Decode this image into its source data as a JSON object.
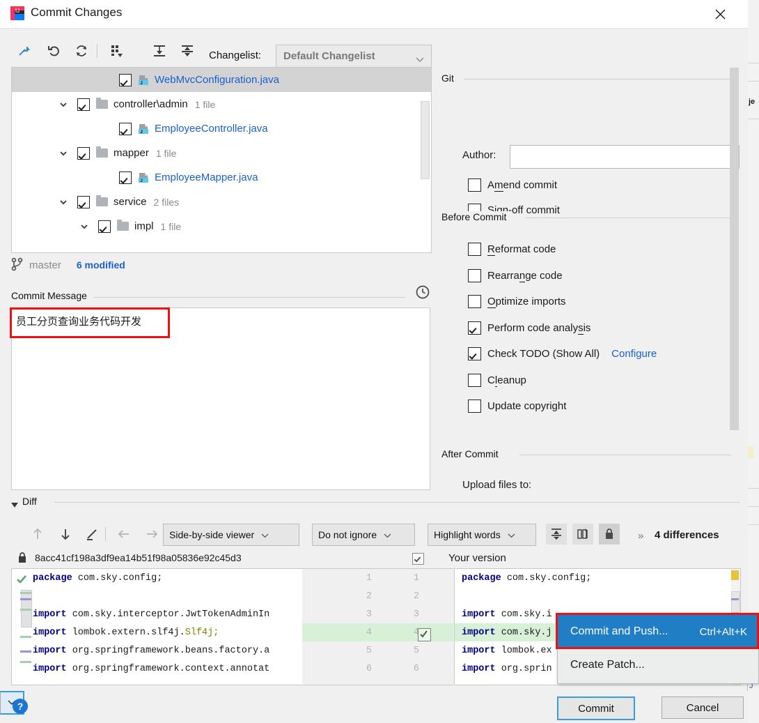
{
  "window": {
    "title": "Commit Changes",
    "app_icon": "intellij-idea-icon",
    "close_icon": "close-icon"
  },
  "toolbar": {
    "icons": [
      {
        "name": "collapse-selection-icon",
        "glyph": "arrows-in"
      },
      {
        "name": "revert-icon",
        "glyph": "undo"
      },
      {
        "name": "refresh-icon",
        "glyph": "refresh"
      },
      {
        "name": "group-by-icon",
        "glyph": "grid-dropdown"
      },
      {
        "name": "expand-all-icon",
        "glyph": "expand"
      },
      {
        "name": "collapse-all-icon",
        "glyph": "collapse"
      }
    ],
    "changelist_label": "Changelist:",
    "changelist_value": "Default Changelist"
  },
  "tree": {
    "rows": [
      {
        "indent": 3,
        "twisty": false,
        "checked": true,
        "kind": "file",
        "name": "WebMvcConfiguration.java",
        "count": "",
        "selected": true
      },
      {
        "indent": 1,
        "twisty": true,
        "checked": true,
        "kind": "folder",
        "name": "controller\\admin",
        "count": "1 file",
        "selected": false
      },
      {
        "indent": 3,
        "twisty": false,
        "checked": true,
        "kind": "file",
        "name": "EmployeeController.java",
        "count": "",
        "selected": false
      },
      {
        "indent": 1,
        "twisty": true,
        "checked": true,
        "kind": "folder",
        "name": "mapper",
        "count": "1 file",
        "selected": false
      },
      {
        "indent": 3,
        "twisty": false,
        "checked": true,
        "kind": "file",
        "name": "EmployeeMapper.java",
        "count": "",
        "selected": false
      },
      {
        "indent": 1,
        "twisty": true,
        "checked": true,
        "kind": "folder",
        "name": "service",
        "count": "2 files",
        "selected": false
      },
      {
        "indent": 2,
        "twisty": true,
        "checked": true,
        "kind": "folder",
        "name": "impl",
        "count": "1 file",
        "selected": false
      }
    ]
  },
  "branch": {
    "icon": "git-branch-icon",
    "name": "master",
    "modified": "6 modified"
  },
  "commit_message": {
    "section_label": "Commit Message",
    "history_icon": "clock-icon",
    "value": "员工分页查询业务代码开发",
    "highlight_color": "#ee1111"
  },
  "git_section": {
    "title": "Git",
    "author_label": "Author:",
    "author_value": "",
    "checkboxes": [
      {
        "label": "Amend commit",
        "checked": false,
        "mnemonic": "m"
      },
      {
        "label": "Sign-off commit",
        "checked": false,
        "mnemonic": "g"
      }
    ]
  },
  "before_commit": {
    "title": "Before Commit",
    "checkboxes": [
      {
        "label": "Reformat code",
        "checked": false,
        "mnemonic": "R"
      },
      {
        "label": "Rearrange code",
        "checked": false,
        "mnemonic": "n"
      },
      {
        "label": "Optimize imports",
        "checked": false,
        "mnemonic": "O"
      },
      {
        "label": "Perform code analysis",
        "checked": true,
        "mnemonic": "s"
      },
      {
        "label": "Check TODO (Show All)",
        "checked": true,
        "mnemonic": "",
        "link": "Configure"
      },
      {
        "label": "Cleanup",
        "checked": false,
        "mnemonic": "l"
      },
      {
        "label": "Update copyright",
        "checked": false,
        "mnemonic": ""
      }
    ]
  },
  "after_commit": {
    "title": "After Commit",
    "upload_label": "Upload files to:"
  },
  "diff": {
    "section_label": "Diff",
    "toolbar": {
      "icons": [
        {
          "name": "previous-difference-icon",
          "glyph": "arrow-up"
        },
        {
          "name": "next-difference-icon",
          "glyph": "arrow-down"
        },
        {
          "name": "edit-icon",
          "glyph": "pencil"
        },
        {
          "name": "apply-left-icon",
          "glyph": "arrow-left"
        },
        {
          "name": "apply-right-icon",
          "glyph": "arrow-right"
        }
      ],
      "viewer_mode": "Side-by-side viewer",
      "ignore_mode": "Do not ignore",
      "highlight_mode": "Highlight words",
      "collapse_unchanged_icon": "collapse-unchanged-icon",
      "sync_scroll_icon": "synchronize-scroll-icon",
      "readonly_icon": "lock-icon",
      "more_icon": "chevron-double-right-icon",
      "differences_count": "4 differences"
    },
    "left_header": {
      "lock_icon": "lock-icon",
      "revision": "8acc41cf198a3df9ea14b51f98a05836e92c45d3"
    },
    "right_header": {
      "label": "Your version",
      "checkbox_checked": true
    },
    "left_lines": [
      {
        "n": 1,
        "tokens": [
          {
            "t": "package",
            "c": "kw"
          },
          {
            "t": " com.sky.config;",
            "c": "pl"
          }
        ],
        "marker": "accept-check"
      },
      {
        "n": 2,
        "tokens": []
      },
      {
        "n": 3,
        "tokens": [
          {
            "t": "import",
            "c": "kw"
          },
          {
            "t": " com.sky.interceptor.JwtTokenAdminIn",
            "c": "pl"
          }
        ]
      },
      {
        "n": 4,
        "tokens": [
          {
            "t": "import",
            "c": "kw"
          },
          {
            "t": " lombok.extern.slf4j.",
            "c": "pl"
          },
          {
            "t": "Slf4j;",
            "c": "ann"
          }
        ]
      },
      {
        "n": 5,
        "tokens": [
          {
            "t": "import",
            "c": "kw"
          },
          {
            "t": " org.springframework.beans.factory.a",
            "c": "pl"
          }
        ]
      },
      {
        "n": 6,
        "tokens": [
          {
            "t": "import",
            "c": "kw"
          },
          {
            "t": " org.springframework.context.annotat",
            "c": "pl"
          }
        ]
      }
    ],
    "right_lines": [
      {
        "n": 1,
        "tokens": [
          {
            "t": "package",
            "c": "kw"
          },
          {
            "t": " com.sky.config;",
            "c": "pl"
          }
        ]
      },
      {
        "n": 2,
        "tokens": []
      },
      {
        "n": 3,
        "tokens": [
          {
            "t": "import",
            "c": "kw"
          },
          {
            "t": " com.sky.i",
            "c": "pl"
          }
        ]
      },
      {
        "n": 4,
        "tokens": [
          {
            "t": "import",
            "c": "kw"
          },
          {
            "t": " com.sky.j",
            "c": "pl"
          }
        ],
        "changed": true
      },
      {
        "n": 5,
        "tokens": [
          {
            "t": "import",
            "c": "kw"
          },
          {
            "t": " lombok.ex",
            "c": "pl"
          }
        ]
      },
      {
        "n": 6,
        "tokens": [
          {
            "t": "import",
            "c": "kw"
          },
          {
            "t": " org.sprin",
            "c": "pl"
          }
        ]
      }
    ]
  },
  "popup": {
    "items": [
      {
        "label": "Commit and Push...",
        "accelerator": "Ctrl+Alt+K",
        "highlighted": true
      },
      {
        "label": "Create Patch...",
        "accelerator": "",
        "highlighted": false
      }
    ],
    "highlight_color": "#ee1111"
  },
  "footer": {
    "help_icon": "help-icon",
    "help_glyph": "?",
    "commit_label": "Commit",
    "commit_dropdown_icon": "chevron-down-icon",
    "cancel_label": "Cancel"
  },
  "background_window": {
    "label": "je"
  }
}
